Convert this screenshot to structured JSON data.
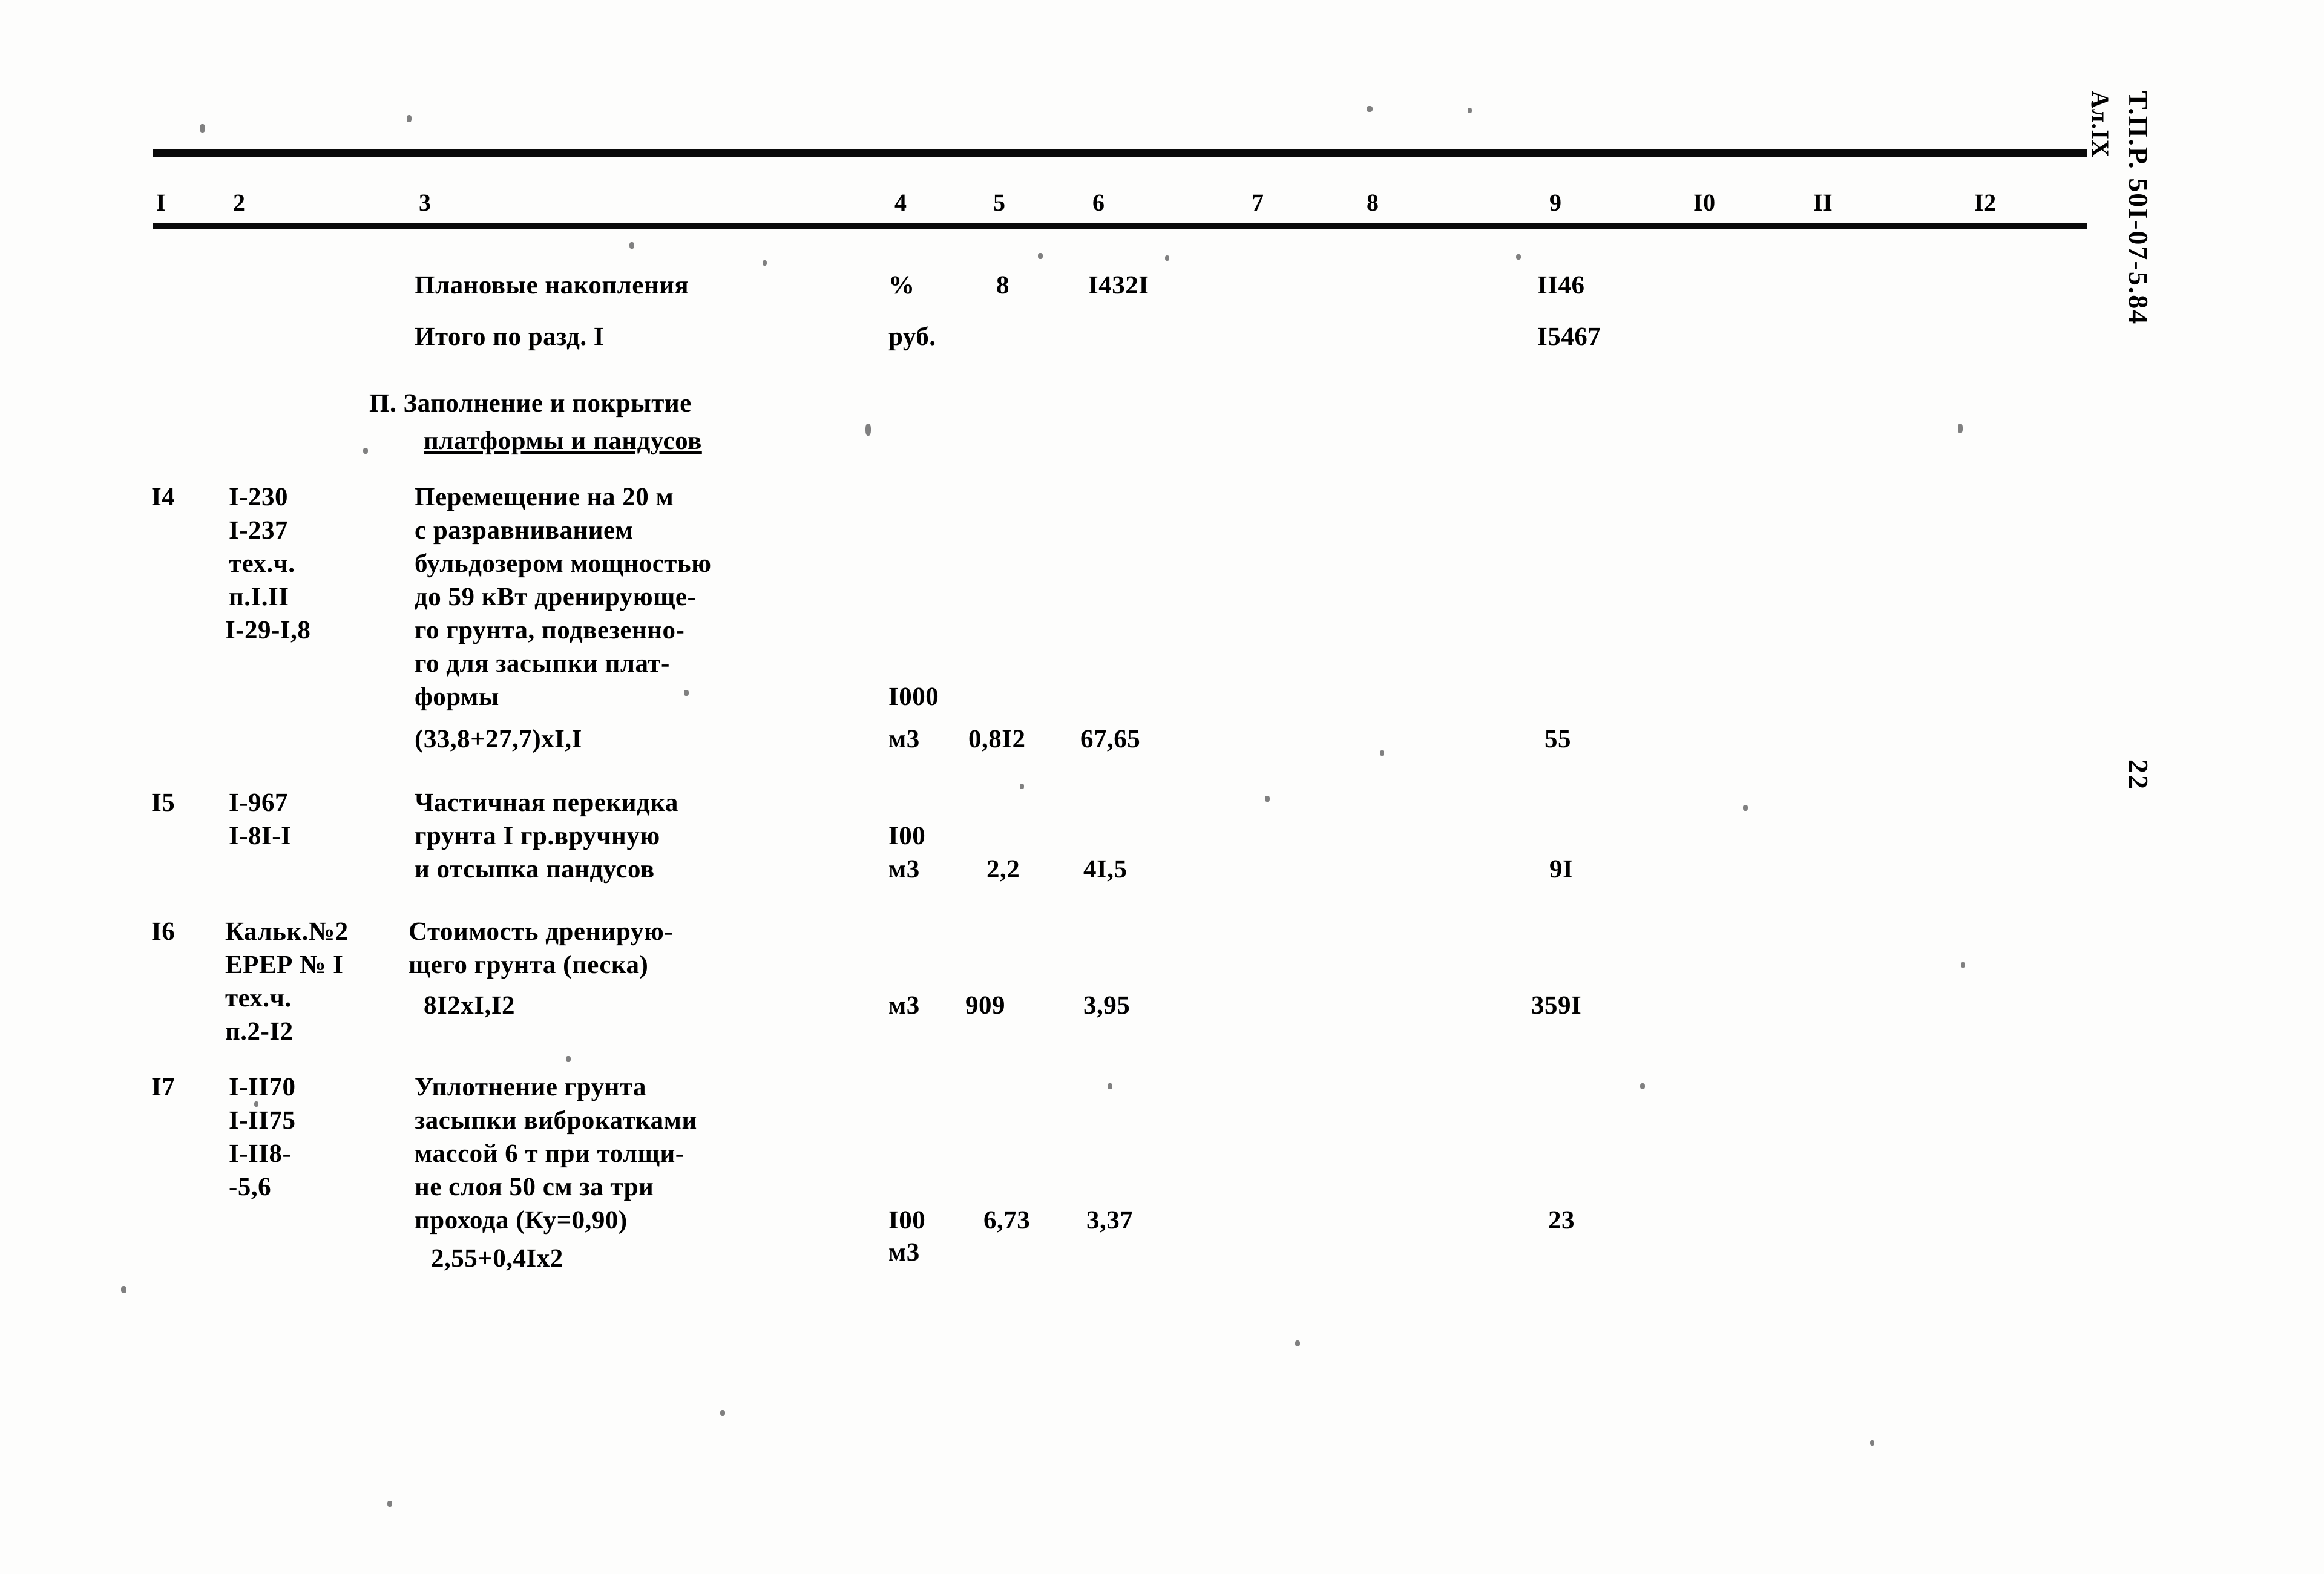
{
  "document": {
    "margin_code": "Т.П.Р. 50I-07-5.84",
    "margin_album": "Ал.IX",
    "page_number": "22"
  },
  "table": {
    "column_headers": [
      "I",
      "2",
      "3",
      "4",
      "5",
      "6",
      "7",
      "8",
      "9",
      "I0",
      "II",
      "I2"
    ],
    "summary_rows": [
      {
        "description": "Плановые накопления",
        "unit": "%",
        "col5": "8",
        "col6": "I432I",
        "col9": "II46"
      },
      {
        "description": "Итого по разд. I",
        "unit": "руб.",
        "col5": "",
        "col6": "",
        "col9": "I5467"
      }
    ],
    "section_heading": {
      "line1": "П. Заполнение и покрытие",
      "line2": "платформы и пандусов"
    },
    "rows": [
      {
        "no": "I4",
        "codes": [
          "I-230",
          "I-237",
          "тех.ч.",
          "п.I.II",
          "I-29-I,8"
        ],
        "description_lines": [
          "Перемещение на 20 м",
          "с разравниванием",
          "бульдозером мощностью",
          "до 59 кВт дренирующе-",
          "го грунта, подвезенно-",
          "го для засыпки плат-",
          "формы"
        ],
        "calc": "(33,8+27,7)хI,I",
        "unit_line1": "I000",
        "unit_line2": "м3",
        "col5": "0,8I2",
        "col6": "67,65",
        "col9": "55"
      },
      {
        "no": "I5",
        "codes": [
          "I-967",
          "I-8I-I"
        ],
        "description_lines": [
          "Частичная перекидка",
          "грунта I гр.вручную",
          "и отсыпка пандусов"
        ],
        "calc": "",
        "unit_line1": "I00",
        "unit_line2": "м3",
        "col5": "2,2",
        "col6": "4I,5",
        "col9": "9I"
      },
      {
        "no": "I6",
        "codes": [
          "Кальк.№2",
          "ЕРЕР № I",
          "тех.ч.",
          "п.2-I2"
        ],
        "description_lines": [
          "Стоимость дренирую-",
          "щего грунта (песка)"
        ],
        "calc": "8I2хI,I2",
        "unit_line1": "",
        "unit_line2": "м3",
        "col5": "909",
        "col6": "3,95",
        "col9": "359I"
      },
      {
        "no": "I7",
        "codes": [
          "I-II70",
          "I-II75",
          "I-II8-",
          "-5,6"
        ],
        "description_lines": [
          "Уплотнение грунта",
          "засыпки виброкатками",
          "массой 6 т при толщи-",
          "не слоя 50 см за три",
          "прохода (Ку=0,90)"
        ],
        "calc": "2,55+0,4Iх2",
        "unit_line1": "I00",
        "unit_line2": "м3",
        "col5": "6,73",
        "col6": "3,37",
        "col9": "23"
      }
    ]
  }
}
